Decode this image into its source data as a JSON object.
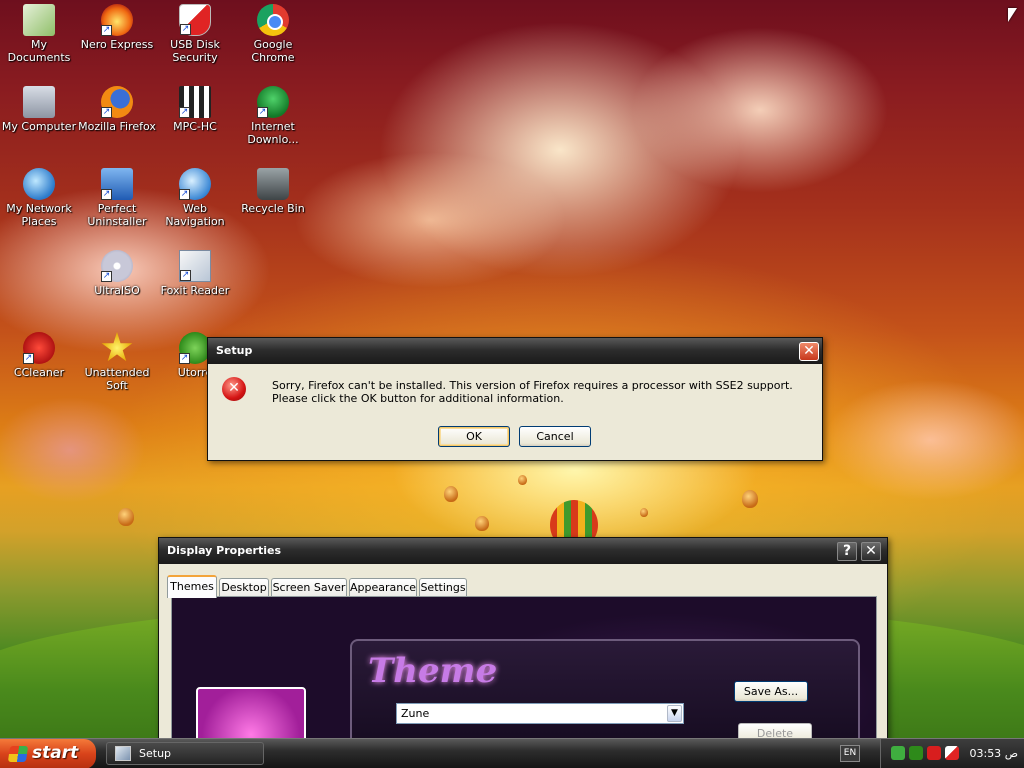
{
  "desktop": {
    "icons": [
      {
        "label": "My Documents"
      },
      {
        "label": "Nero Express"
      },
      {
        "label": "USB Disk Security"
      },
      {
        "label": "Google Chrome"
      },
      {
        "label": "My Computer"
      },
      {
        "label": "Mozilla Firefox"
      },
      {
        "label": "MPC-HC"
      },
      {
        "label": "Internet Downlo..."
      },
      {
        "label": "My Network Places"
      },
      {
        "label": "Perfect Uninstaller"
      },
      {
        "label": "Web Navigation"
      },
      {
        "label": "Recycle Bin"
      },
      {
        "label": "UltraISO"
      },
      {
        "label": "Foxit Reader"
      },
      {
        "label": "CCleaner"
      },
      {
        "label": "Unattended Soft"
      },
      {
        "label": "Utorre"
      }
    ]
  },
  "setup_dialog": {
    "title": "Setup",
    "close_label": "✕",
    "message": "Sorry, Firefox can't be installed. This version of Firefox requires a processor with SSE2 support. Please click the OK button for additional information.",
    "ok_label": "OK",
    "cancel_label": "Cancel",
    "icon": "error-icon"
  },
  "display_properties": {
    "title": "Display Properties",
    "help_label": "?",
    "close_label": "✕",
    "tabs": [
      {
        "label": "Themes",
        "active": true
      },
      {
        "label": "Desktop",
        "active": false
      },
      {
        "label": "Screen Saver",
        "active": false
      },
      {
        "label": "Appearance",
        "active": false
      },
      {
        "label": "Settings",
        "active": false
      }
    ],
    "theme_heading": "Theme",
    "theme_value": "Zune",
    "save_as_label": "Save As...",
    "delete_label": "Delete"
  },
  "taskbar": {
    "start_label": "start",
    "tasks": [
      {
        "label": "Setup"
      }
    ],
    "language": "EN",
    "clock": "03:53 ص"
  },
  "colors": {
    "accent": "#f3a43b",
    "start_button": "#d8431a",
    "close_red": "#c7381c",
    "error_red": "#d51414"
  }
}
